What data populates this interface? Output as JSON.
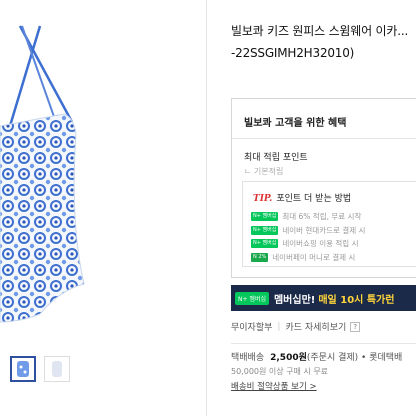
{
  "product": {
    "title_line1": "빌보콰 키즈 원피스 스윔웨어 이카...",
    "title_line2": "-22SSGIMH2H32010)"
  },
  "benefits": {
    "heading": "빌보콰 고객을 위한 혜택",
    "max_points_label": "최대 적립 포인트",
    "base_points_label": "기본적립",
    "tip_label": "TIP.",
    "tip_title": "포인트 더 받는 방법",
    "tips": [
      {
        "badge": "N+ 멤버십",
        "text": "최대 6% 적립, 무료 시작"
      },
      {
        "badge": "N+ 멤버십",
        "text": "네이버 현대카드로 결제 시"
      },
      {
        "badge": "N+ 멤버십",
        "text": "네이버쇼핑 이용 적립 시"
      },
      {
        "badge": "N 2%",
        "text": "네이버페이 머니로 결제 시"
      }
    ]
  },
  "banner": {
    "badge": "N+ 멤버십",
    "text": "멤버십만!",
    "highlight": "매일 10시 특가런"
  },
  "card": {
    "left": "무이자할부",
    "right": "카드 자세히보기",
    "help": "?"
  },
  "shipping": {
    "label": "택배배송",
    "price": "2,500원",
    "condition": "(주문시 결제) • 롯데택배",
    "sub": "50,000원 이상 구매 시 무료",
    "link": "배송비 절약상품 보기 >"
  }
}
